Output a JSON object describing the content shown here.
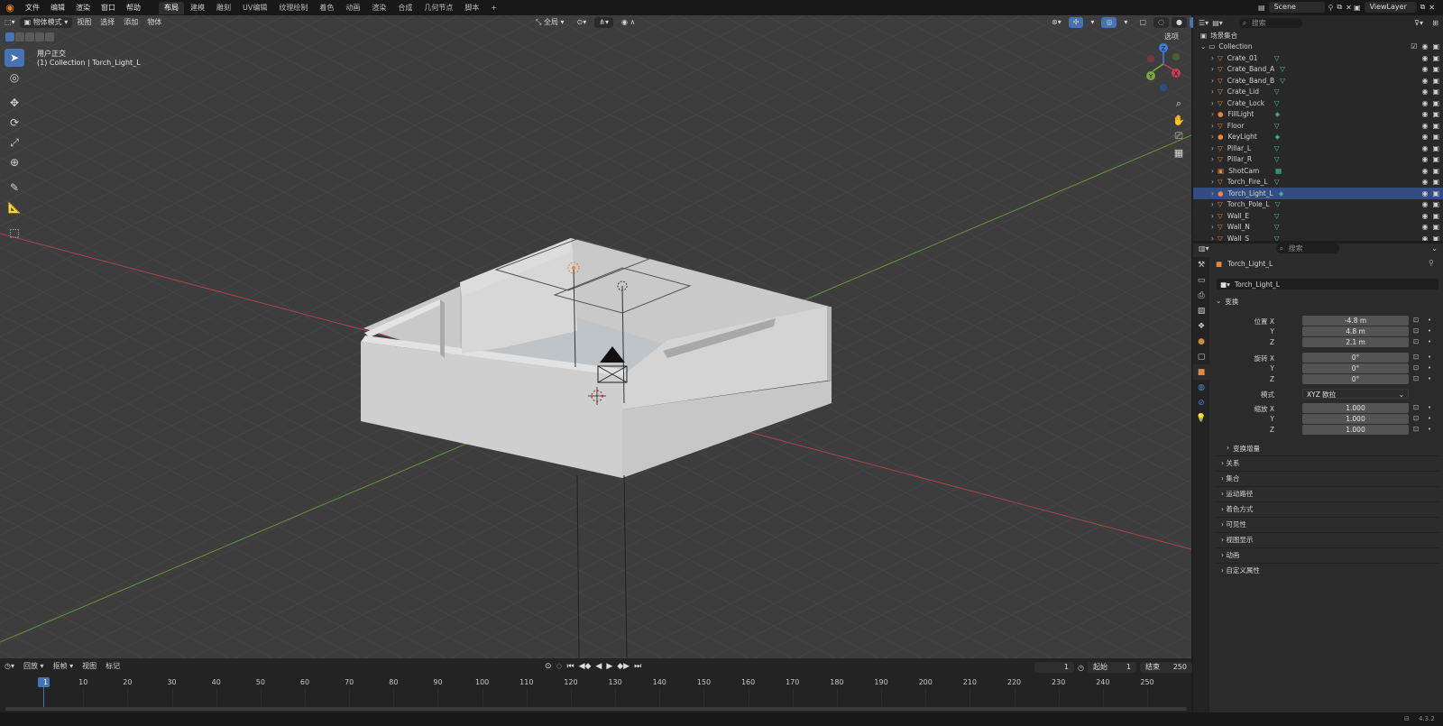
{
  "topbar": {
    "menus": [
      "文件",
      "编辑",
      "渲染",
      "窗口",
      "帮助"
    ],
    "tabs": [
      "布局",
      "建模",
      "雕刻",
      "UV编辑",
      "纹理绘制",
      "着色",
      "动画",
      "渲染",
      "合成",
      "几何节点",
      "脚本"
    ],
    "active_tab": "布局",
    "add_tab": "+",
    "scene": "Scene",
    "viewlayer": "ViewLayer"
  },
  "viewport_header": {
    "mode": "物体模式",
    "menus": [
      "视图",
      "选择",
      "添加",
      "物体"
    ],
    "transform_orientation": "全局",
    "options": "选项"
  },
  "viewport": {
    "view_name": "用户正交",
    "context": "(1) Collection | Torch_Light_L",
    "gizmo": {
      "x": "X",
      "y": "Y",
      "z": "Z"
    }
  },
  "timeline": {
    "menus": [
      "回放",
      "抠帧",
      "视图",
      "标记"
    ],
    "current_frame": "1",
    "start_label": "起始",
    "start": "1",
    "end_label": "结束",
    "end": "250",
    "ticks": [
      "1",
      "10",
      "20",
      "30",
      "40",
      "50",
      "60",
      "70",
      "80",
      "90",
      "100",
      "110",
      "120",
      "130",
      "140",
      "150",
      "160",
      "170",
      "180",
      "190",
      "200",
      "210",
      "220",
      "230",
      "240",
      "250"
    ]
  },
  "outliner": {
    "search_placeholder": "搜索",
    "scene_collection": "场景集合",
    "collection": "Collection",
    "items": [
      {
        "name": "Crate_01",
        "type": "mesh"
      },
      {
        "name": "Crate_Band_A",
        "type": "mesh"
      },
      {
        "name": "Crate_Band_B",
        "type": "mesh"
      },
      {
        "name": "Crate_Lid",
        "type": "mesh"
      },
      {
        "name": "Crate_Lock",
        "type": "mesh"
      },
      {
        "name": "FillLight",
        "type": "light"
      },
      {
        "name": "Floor",
        "type": "mesh"
      },
      {
        "name": "KeyLight",
        "type": "light"
      },
      {
        "name": "Pillar_L",
        "type": "mesh"
      },
      {
        "name": "Pillar_R",
        "type": "mesh"
      },
      {
        "name": "ShotCam",
        "type": "camera"
      },
      {
        "name": "Torch_Fire_L",
        "type": "mesh"
      },
      {
        "name": "Torch_Light_L",
        "type": "light",
        "selected": true
      },
      {
        "name": "Torch_Pole_L",
        "type": "mesh"
      },
      {
        "name": "Wall_E",
        "type": "mesh"
      },
      {
        "name": "Wall_N",
        "type": "mesh"
      },
      {
        "name": "Wall_S",
        "type": "mesh"
      }
    ]
  },
  "properties": {
    "search_placeholder": "搜索",
    "object_name": "Torch_Light_L",
    "datablock_name": "Torch_Light_L",
    "transform_title": "变换",
    "location_label": "位置 X",
    "rotation_label": "旋转 X",
    "scale_label": "缩放 X",
    "y_label": "Y",
    "z_label": "Z",
    "location": [
      "-4.8 m",
      "4.8 m",
      "2.1 m"
    ],
    "rotation": [
      "0°",
      "0°",
      "0°"
    ],
    "mode_label": "模式",
    "mode_value": "XYZ 欧拉",
    "scale": [
      "1.000",
      "1.000",
      "1.000"
    ],
    "delta_transform": "变换增量",
    "panels": [
      "关系",
      "集合",
      "运动路径",
      "着色方式",
      "可见性",
      "视图显示",
      "动画",
      "自定义属性"
    ]
  },
  "status": {
    "version": "4.3.2"
  },
  "colors": {
    "accent": "#4772b3",
    "orange_object": "#e8883a",
    "mesh_green": "#48c7a0",
    "x_axis": "#c0404f",
    "y_axis": "#7aa83a",
    "z_axis": "#3f7fd8"
  }
}
